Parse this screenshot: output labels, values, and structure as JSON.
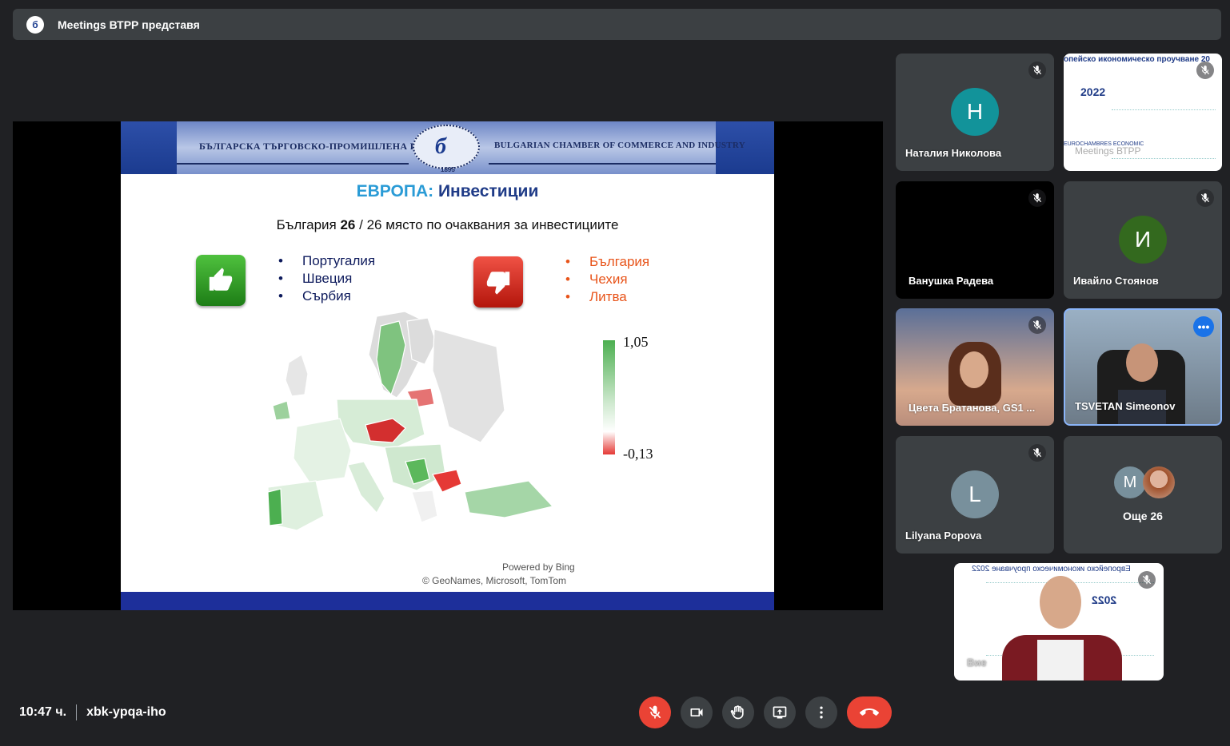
{
  "meeting": {
    "title": "Meetings ВТРР представя",
    "logo_glyph": "б",
    "time": "10:47 ч.",
    "code": "xbk-ypqa-iho"
  },
  "slide": {
    "banner_left": "БЪЛГАРСКА ТЪРГОВСКО-ПРОМИШЛЕНА ПАЛАТА",
    "banner_right": "BULGARIAN CHAMBER OF COMMERCE AND INDUSTRY",
    "seal_year": "1895",
    "title_part1": "ЕВРОПА:",
    "title_part2": "Инвестиции",
    "subtitle_pre": "България",
    "subtitle_rank": "26",
    "subtitle_post": "/ 26 място по очаквания за инвестициите",
    "good_countries": [
      "Португалия",
      "Швеция",
      "Сърбия"
    ],
    "bad_countries": [
      "България",
      "Чехия",
      "Литва"
    ],
    "legend_max": "1,05",
    "legend_min": "-0,13",
    "powered": "Powered by Bing",
    "copyright": "© GeoNames, Microsoft, TomTom"
  },
  "participants": [
    {
      "name": "Наталия Николова",
      "initial": "Н",
      "color": "#12939a"
    },
    {
      "name": "Ванушка Радева"
    },
    {
      "name": "Ивайло Стоянов",
      "initial": "И",
      "color": "#33691e"
    },
    {
      "name": "Цвета Братанова, GS1 ..."
    },
    {
      "name": "TSVETAN Simeonov"
    },
    {
      "name": "Lilyana Popova",
      "initial": "L",
      "color": "#78909c"
    }
  ],
  "presentation_tile": {
    "header": "опейско икономическо проучване 20",
    "year": "2022",
    "label1": "EUROCHAMBRES ECONOMIC",
    "label2": "Meetings ВТРР"
  },
  "more_tile": {
    "initial": "M",
    "label": "Още 26"
  },
  "self_tile": {
    "header": "Европейско икономическо проучване 2022",
    "year": "2022",
    "label": "Вие"
  },
  "colors": {
    "end_call": "#ea4335",
    "background": "#202124",
    "tile": "#3c4043"
  }
}
